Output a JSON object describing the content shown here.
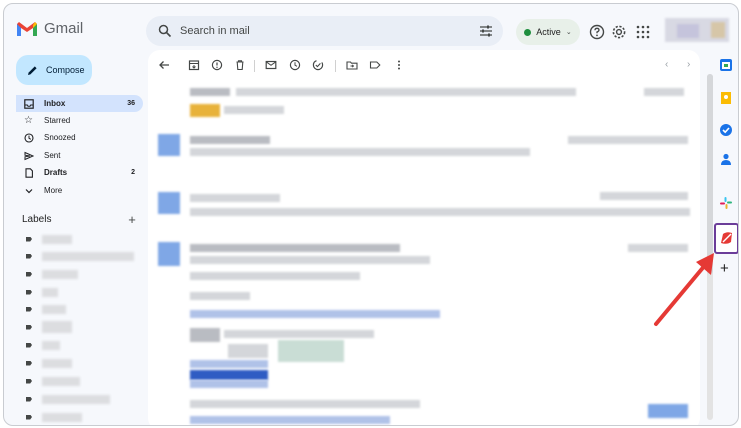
{
  "app": {
    "brand": "Gmail"
  },
  "search": {
    "placeholder": "Search in mail"
  },
  "status": {
    "label": "Active"
  },
  "compose": {
    "label": "Compose"
  },
  "nav": [
    {
      "label": "Inbox",
      "count": "36",
      "icon": "inbox-icon",
      "active": true
    },
    {
      "label": "Starred",
      "count": "",
      "icon": "star-icon"
    },
    {
      "label": "Snoozed",
      "count": "",
      "icon": "clock-icon"
    },
    {
      "label": "Sent",
      "count": "",
      "icon": "send-icon"
    },
    {
      "label": "Drafts",
      "count": "2",
      "icon": "draft-icon",
      "bold": true
    },
    {
      "label": "More",
      "count": "",
      "icon": "chevron-down-icon"
    }
  ],
  "labels": {
    "heading": "Labels",
    "add": "+"
  },
  "pager": {
    "prev": "‹",
    "next": "›"
  },
  "rail": {
    "add": "+"
  },
  "colors": {
    "accent": "#c2e7ff",
    "active_nav": "#d3e3fd",
    "status_green": "#1e8e3e",
    "highlight_box": "#6b3d99",
    "arrow": "#e53935"
  }
}
